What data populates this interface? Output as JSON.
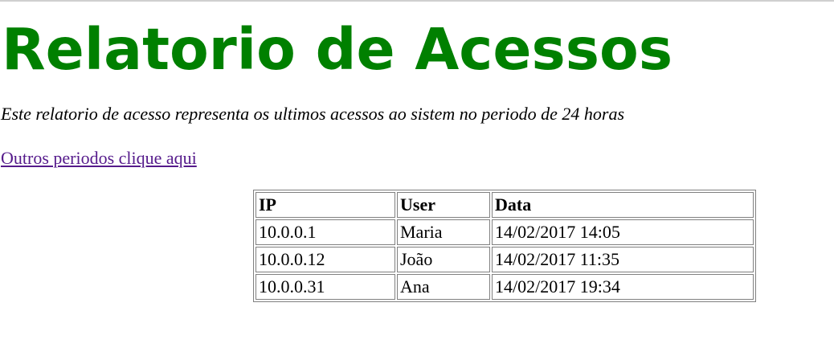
{
  "page": {
    "title": "Relatorio de Acessos",
    "description": "Este relatorio de acesso representa os ultimos acessos ao sistem no periodo de 24 horas",
    "link_text": "Outros periodos clique aqui"
  },
  "colors": {
    "title": "#008000",
    "link_visited": "#551a8b"
  },
  "table": {
    "headers": [
      "IP",
      "User",
      "Data"
    ],
    "rows": [
      [
        "10.0.0.1",
        "Maria",
        "14/02/2017 14:05"
      ],
      [
        "10.0.0.12",
        "João",
        "14/02/2017 11:35"
      ],
      [
        "10.0.0.31",
        "Ana",
        "14/02/2017 19:34"
      ]
    ]
  }
}
